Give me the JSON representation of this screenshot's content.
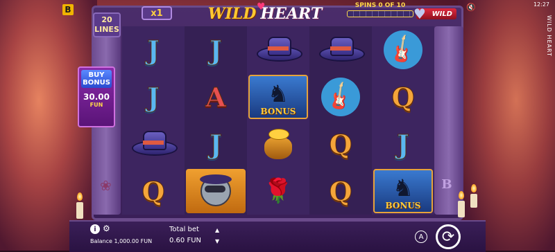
{
  "header": {
    "brand_icon": "B",
    "lines_count": "20",
    "lines_label": "LINES",
    "multiplier": "x1",
    "title_wild": "WILD",
    "title_heart": "HEART",
    "spins_label": "SPINS 0 OF 10",
    "wild_badge": "WILD",
    "clock": "12:27",
    "side_title": "WILD HEART"
  },
  "buy_bonus": {
    "label": "BUY BONUS",
    "amount": "30.00",
    "currency": "FUN"
  },
  "reels": {
    "rows": [
      [
        "J",
        "J",
        "hat",
        "hat",
        "guitar"
      ],
      [
        "J",
        "A",
        "bonus",
        "guitar",
        "Q"
      ],
      [
        "hat",
        "J",
        "pot",
        "Q",
        "J"
      ],
      [
        "Q",
        "raccoon",
        "rose",
        "Q",
        "bonus"
      ]
    ],
    "bonus_label": "BONUS"
  },
  "footer": {
    "balance": "Balance 1,000.00 FUN",
    "total_bet_label": "Total bet",
    "total_bet_value": "0.60 FUN",
    "autoplay_label": "A"
  },
  "colors": {
    "accent_gold": "#ffd84a",
    "frame_purple": "#3a1f58",
    "bonus_border": "#e8a33a"
  }
}
